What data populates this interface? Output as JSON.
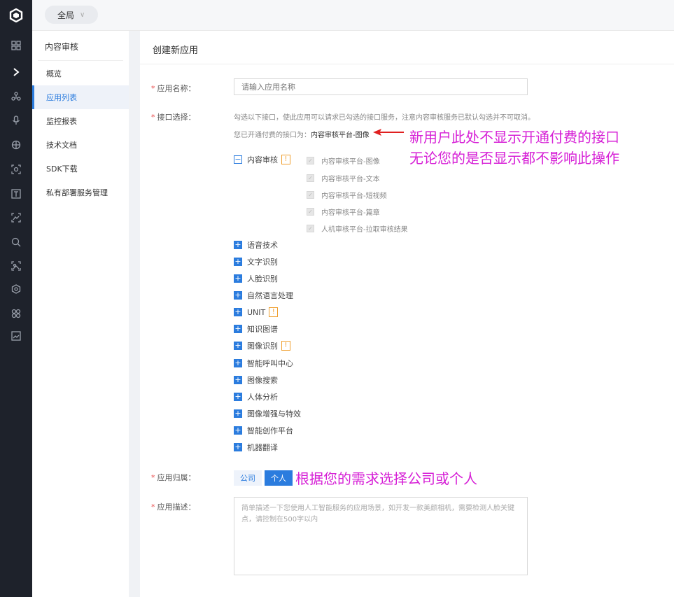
{
  "topbar": {
    "scope_label": "全局"
  },
  "rail": {
    "icons": [
      "logo-icon",
      "grid-icon",
      "chevron-right-icon",
      "nodes-icon",
      "mic-icon",
      "globe-icon",
      "face-scan-icon",
      "text-icon",
      "image-icon",
      "search-icon",
      "image2-icon",
      "gear-icon",
      "apps-icon",
      "photo-icon"
    ]
  },
  "sidebar": {
    "title": "内容审核",
    "items": [
      {
        "label": "概览"
      },
      {
        "label": "应用列表"
      },
      {
        "label": "监控报表"
      },
      {
        "label": "技术文档"
      },
      {
        "label": "SDK下载"
      },
      {
        "label": "私有部署服务管理"
      }
    ]
  },
  "main": {
    "header": "创建新应用",
    "name": {
      "label": "应用名称：",
      "placeholder": "请输入应用名称"
    },
    "api": {
      "label": "接口选择：",
      "note": "勾选以下接口，使此应用可以请求已勾选的接口服务，注意内容审核服务已默认勾选并不可取消。",
      "opened_prefix": "您已开通付费的接口为：",
      "opened_value": "内容审核平台-图像",
      "group": {
        "label": "内容审核",
        "children": [
          "内容审核平台-图像",
          "内容审核平台-文本",
          "内容审核平台-短视频",
          "内容审核平台-篇章",
          "人机审核平台-拉取审核结果"
        ]
      },
      "others": [
        "语音技术",
        "文字识别",
        "人脸识别",
        "自然语言处理",
        "UNIT",
        "知识图谱",
        "图像识别",
        "智能呼叫中心",
        "图像搜索",
        "人体分析",
        "图像增强与特效",
        "智能创作平台",
        "机器翻译"
      ]
    },
    "owner": {
      "label": "应用归属：",
      "company": "公司",
      "personal": "个人"
    },
    "desc": {
      "label": "应用描述：",
      "placeholder": "简单描述一下您使用人工智能服务的应用场景，如开发一款美颜相机，需要检测人脸关键点，请控制在500字以内"
    }
  },
  "annotations": {
    "line1": "新用户此处不显示开通付费的接口",
    "line2": "无论您的是否显示都不影响此操作",
    "line3": "根据您的需求选择公司或个人"
  },
  "colors": {
    "accent": "#2b7cde",
    "annotation": "#d61fd6",
    "rail": "#1e222b"
  }
}
